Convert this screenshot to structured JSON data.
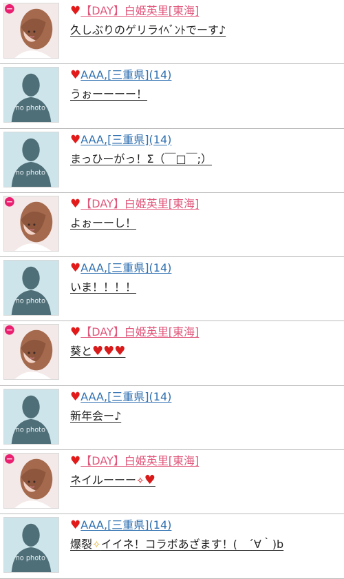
{
  "posts": [
    {
      "author": "【DAY】白姫英里[東海]",
      "author_color": "#e0557a",
      "avatar": "photo-girl",
      "message": "久しぶりのゲリラｲﾍﾞﾝﾄでーす♪"
    },
    {
      "author": "AAA,[三重県](14)",
      "author_color": "#2e6fb0",
      "avatar": "no-photo",
      "no_photo_label": "no photo",
      "message": "うぉーーーー！"
    },
    {
      "author": "AAA,[三重県](14)",
      "author_color": "#2e6fb0",
      "avatar": "no-photo",
      "no_photo_label": "no photo",
      "message": "まっひーがっ！Σ（￣□￣;）"
    },
    {
      "author": "【DAY】白姫英里[東海]",
      "author_color": "#e0557a",
      "avatar": "photo-girl",
      "message": "よぉーーし！"
    },
    {
      "author": "AAA,[三重県](14)",
      "author_color": "#2e6fb0",
      "avatar": "no-photo",
      "no_photo_label": "no photo",
      "message": "いま！！！！"
    },
    {
      "author": "【DAY】白姫英里[東海]",
      "author_color": "#e0557a",
      "avatar": "photo-girl",
      "message_prefix": "葵と",
      "message_suffix_hearts": "♥♥♥"
    },
    {
      "author": "AAA,[三重県](14)",
      "author_color": "#2e6fb0",
      "avatar": "no-photo",
      "no_photo_label": "no photo",
      "message": "新年会ー♪"
    },
    {
      "author": "【DAY】白姫英里[東海]",
      "author_color": "#e0557a",
      "avatar": "photo-girl",
      "message_prefix": "ネイルーーー",
      "message_suffix_hearts": "♥"
    },
    {
      "author": "AAA,[三重県](14)",
      "author_color": "#2e6fb0",
      "avatar": "no-photo",
      "no_photo_label": "no photo",
      "message_prefix": "爆裂",
      "message_suffix": "イイネ！コラボあざます！(　´∀｀)b"
    }
  ],
  "heart_glyph": "♥",
  "sparkle_glyph": "✧"
}
